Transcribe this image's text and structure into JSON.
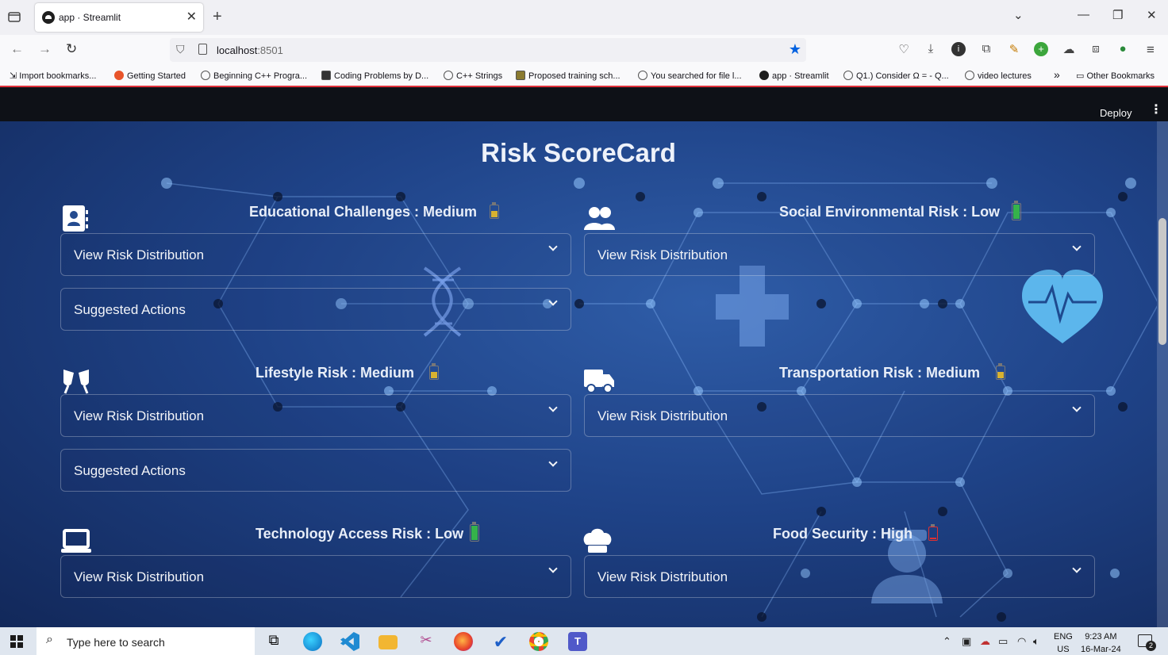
{
  "browser": {
    "tab_title": "app · Streamlit",
    "url_host": "localhost",
    "url_port": ":8501",
    "bookmarks": [
      "Import bookmarks...",
      "Getting Started",
      "Beginning C++ Progra...",
      "Coding Problems by D...",
      "C++ Strings",
      "Proposed training sch...",
      "You searched for file l...",
      "app · Streamlit",
      "Q1.) Consider Ω = - Q...",
      "video lectures"
    ],
    "bookmarks_overflow": "»",
    "other_bookmarks": "Other Bookmarks"
  },
  "app": {
    "deploy_label": "Deploy",
    "title": "Risk ScoreCard",
    "risks": [
      {
        "title": "Educational Challenges : Medium",
        "icon": "id-card-icon",
        "level": "medium",
        "battery_fill": 0.5
      },
      {
        "title": "Social Environmental Risk : Low",
        "icon": "users-icon",
        "level": "low",
        "battery_fill": 1.0
      },
      {
        "title": "Lifestyle Risk : Medium",
        "icon": "glasses-cheers-icon",
        "level": "medium",
        "battery_fill": 0.5
      },
      {
        "title": "Transportation Risk : Medium",
        "icon": "truck-icon",
        "level": "medium",
        "battery_fill": 0.5
      },
      {
        "title": "Technology Access Risk : Low",
        "icon": "laptop-icon",
        "level": "low",
        "battery_fill": 1.0
      },
      {
        "title": "Food Security : High",
        "icon": "chef-hat-icon",
        "level": "high",
        "battery_fill": 0.1
      }
    ],
    "expander_view": "View Risk Distribution",
    "expander_actions": "Suggested Actions",
    "colors": {
      "low": "#35b34a",
      "medium": "#d8b230",
      "high": "#e03030"
    }
  },
  "taskbar": {
    "search_placeholder": "Type here to search",
    "lang_line1": "ENG",
    "lang_line2": "US",
    "time": "9:23 AM",
    "date": "16-Mar-24",
    "notification_count": "2"
  }
}
